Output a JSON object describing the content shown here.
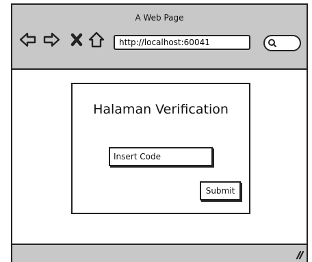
{
  "window": {
    "title": "A Web Page"
  },
  "toolbar": {
    "icons": [
      "back-arrow-icon",
      "forward-arrow-icon",
      "close-x-icon",
      "home-icon"
    ],
    "url": "http://localhost:60041",
    "search_icon": "search-icon"
  },
  "main": {
    "title": "Halaman Verification",
    "code_input": {
      "value": "",
      "placeholder": "Insert Code"
    },
    "submit_label": "Submit"
  },
  "colors": {
    "chrome": "#c8c8c8",
    "outline": "#222222",
    "background": "#ffffff"
  }
}
